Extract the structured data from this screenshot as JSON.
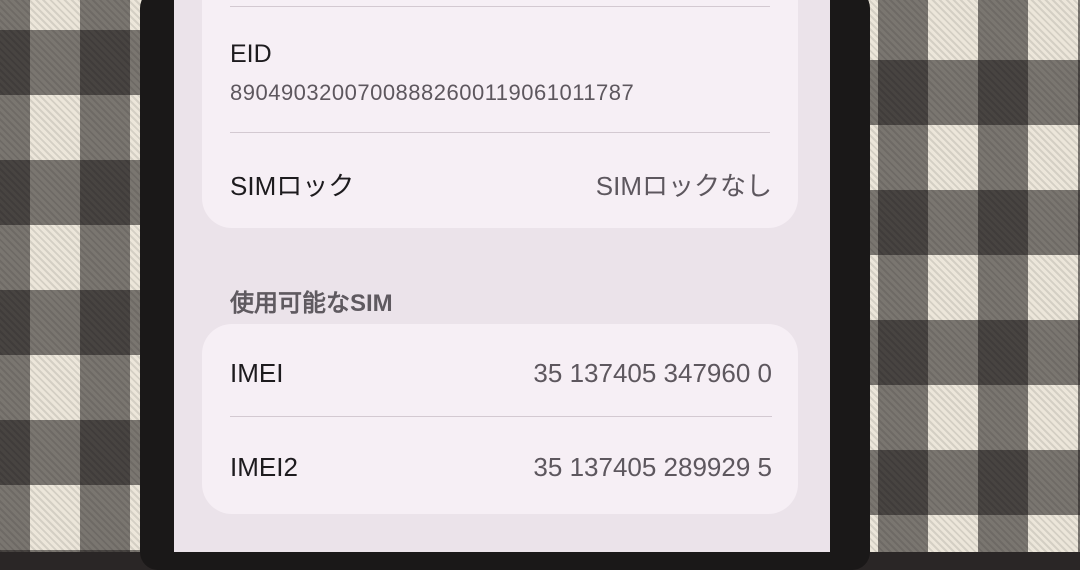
{
  "eid": {
    "label": "EID",
    "value": "89049032007008882600119061011787"
  },
  "sim_lock": {
    "label": "SIMロック",
    "value": "SIMロックなし"
  },
  "available_sim": {
    "header": "使用可能なSIM",
    "rows": [
      {
        "label": "IMEI",
        "value": "35 137405 347960 0"
      },
      {
        "label": "IMEI2",
        "value": "35 137405 289929 5"
      }
    ]
  }
}
